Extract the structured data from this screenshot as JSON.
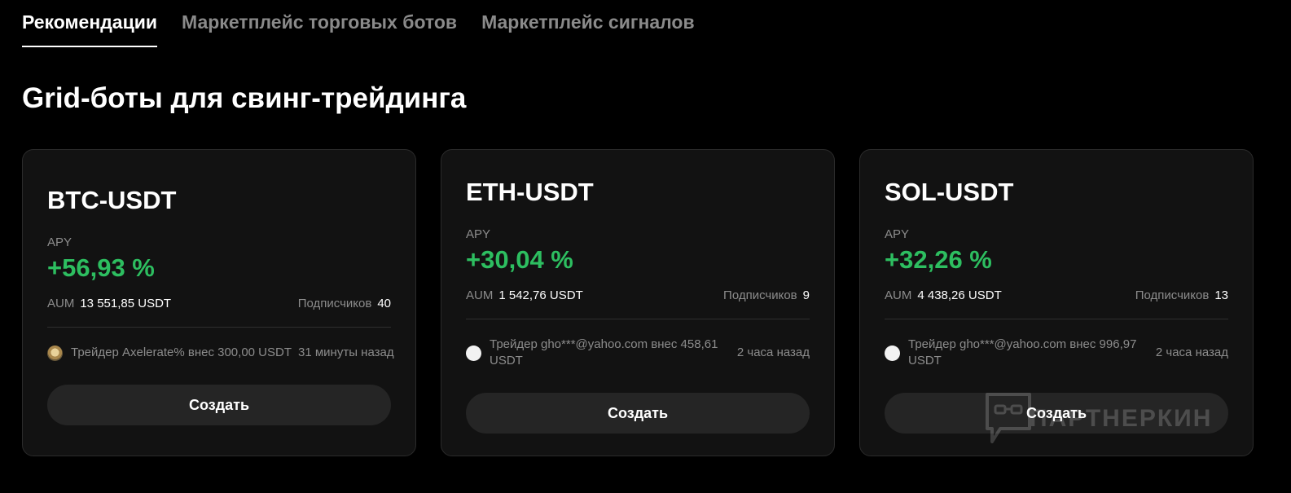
{
  "tabs": [
    {
      "label": "Рекомендации",
      "active": true
    },
    {
      "label": "Маркетплейс торговых ботов",
      "active": false
    },
    {
      "label": "Маркетплейс сигналов",
      "active": false
    }
  ],
  "section_title": "Grid-боты для свинг-трейдинга",
  "colors": {
    "background": "#000000",
    "card": "#121212",
    "positive": "#2dbe60",
    "muted_text": "#8c8c8c",
    "button": "#252525"
  },
  "cards": [
    {
      "pair": "BTC-USDT",
      "apy_label": "APY",
      "apy_value": "+56,93 %",
      "aum_label": "AUM",
      "aum_value": "13 551,85 USDT",
      "subscribers_label": "Подписчиков",
      "subscribers_value": "40",
      "avatar_icon": "trader-avatar-image-icon",
      "activity_text": "Трейдер Axelerate% внес 300,00 USDT",
      "activity_time": "31 минуты назад",
      "button_label": "Создать"
    },
    {
      "pair": "ETH-USDT",
      "apy_label": "APY",
      "apy_value": "+30,04 %",
      "aum_label": "AUM",
      "aum_value": "1 542,76 USDT",
      "subscribers_label": "Подписчиков",
      "subscribers_value": "9",
      "avatar_icon": "trader-avatar-default-icon",
      "activity_text": "Трейдер gho***@yahoo.com внес 458,61 USDT",
      "activity_time": "2 часа назад",
      "button_label": "Создать"
    },
    {
      "pair": "SOL-USDT",
      "apy_label": "APY",
      "apy_value": "+32,26 %",
      "aum_label": "AUM",
      "aum_value": "4 438,26 USDT",
      "subscribers_label": "Подписчиков",
      "subscribers_value": "13",
      "avatar_icon": "trader-avatar-default-icon",
      "activity_text": "Трейдер gho***@yahoo.com внес 996,97 USDT",
      "activity_time": "2 часа назад",
      "button_label": "Создать"
    }
  ],
  "watermark": {
    "text": "ПАРТНЕРКИН",
    "icon": "partnerkin-logo-icon"
  }
}
